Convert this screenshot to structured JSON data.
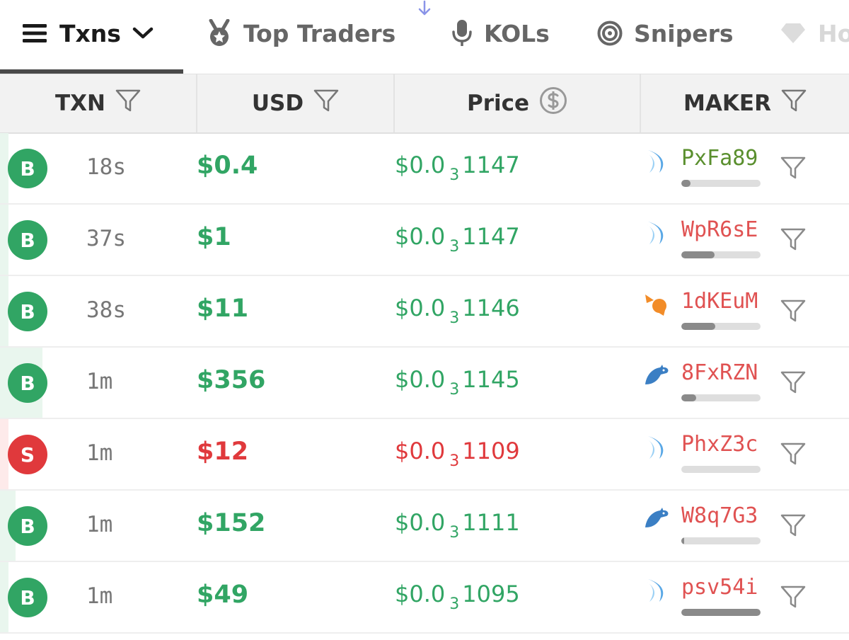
{
  "tabs": {
    "txns": "Txns",
    "top_traders": "Top Traders",
    "kols": "KOLs",
    "snipers": "Snipers",
    "more": "Ho"
  },
  "columns": {
    "txn": "TXN",
    "usd": "USD",
    "price": "Price",
    "maker": "MAKER"
  },
  "colors": {
    "buy": "#31a564",
    "sell": "#e0393c",
    "maker_green": "#5a8f2e",
    "maker_red": "#e05252"
  },
  "rows": [
    {
      "type": "B",
      "age": "18s",
      "usd": "$0.4",
      "price_prefix": "$0.0",
      "price_zeros": "3",
      "price_digits": "1147",
      "maker": "PxFa89",
      "maker_icon": "fish-icon",
      "maker_color": "green",
      "holding": 0.12
    },
    {
      "type": "B",
      "age": "37s",
      "usd": "$1",
      "price_prefix": "$0.0",
      "price_zeros": "3",
      "price_digits": "1147",
      "maker": "WpR6sE",
      "maker_icon": "fish-icon",
      "maker_color": "red",
      "holding": 0.42
    },
    {
      "type": "B",
      "age": "38s",
      "usd": "$11",
      "price_prefix": "$0.0",
      "price_zeros": "3",
      "price_digits": "1146",
      "maker": "1dKEuM",
      "maker_icon": "shrimp-icon",
      "maker_color": "red",
      "holding": 0.43
    },
    {
      "type": "B",
      "age": "1m",
      "usd": "$356",
      "price_prefix": "$0.0",
      "price_zeros": "3",
      "price_digits": "1145",
      "maker": "8FxRZN",
      "maker_icon": "dolphin-icon",
      "maker_color": "red",
      "holding": 0.19
    },
    {
      "type": "S",
      "age": "1m",
      "usd": "$12",
      "price_prefix": "$0.0",
      "price_zeros": "3",
      "price_digits": "1109",
      "maker": "PhxZ3c",
      "maker_icon": "fish-icon",
      "maker_color": "red",
      "holding": 0.0
    },
    {
      "type": "B",
      "age": "1m",
      "usd": "$152",
      "price_prefix": "$0.0",
      "price_zeros": "3",
      "price_digits": "1111",
      "maker": "W8q7G3",
      "maker_icon": "dolphin-icon",
      "maker_color": "red",
      "holding": 0.04
    },
    {
      "type": "B",
      "age": "1m",
      "usd": "$49",
      "price_prefix": "$0.0",
      "price_zeros": "3",
      "price_digits": "1095",
      "maker": "psv54i",
      "maker_icon": "fish-icon",
      "maker_color": "red",
      "holding": 1.0
    }
  ]
}
